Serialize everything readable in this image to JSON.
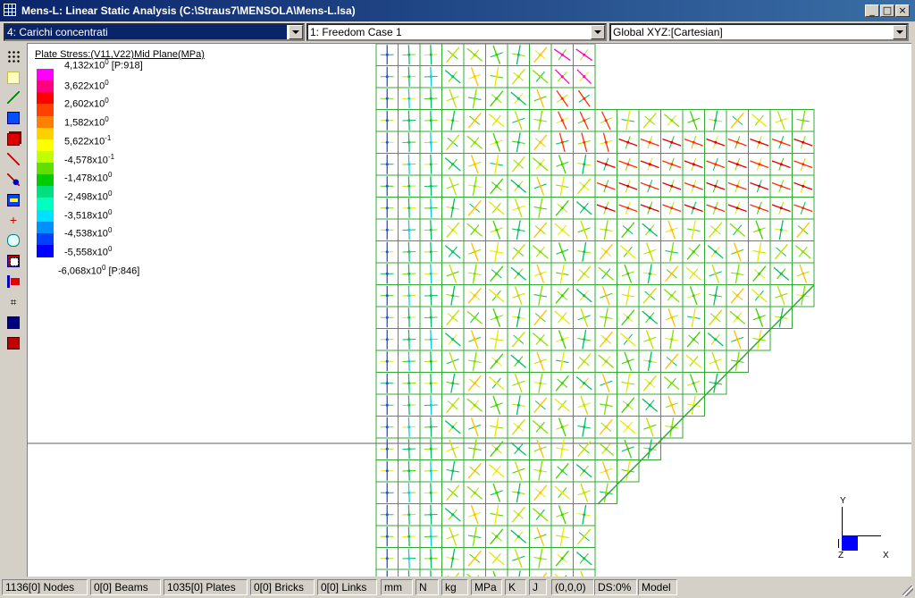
{
  "window": {
    "title": "Mens-L: Linear Static Analysis (C:\\Straus7\\MENSOLA\\Mens-L.lsa)",
    "buttons": [
      "_",
      "□",
      "×"
    ]
  },
  "combos": {
    "load_case": "4: Carichi concentrati",
    "freedom_case": "1: Freedom Case 1",
    "coord_system": "Global XYZ:[Cartesian]"
  },
  "toolbar": [
    "grid-icon",
    "node-icon",
    "beam-icon",
    "plate-icon",
    "brick-icon",
    "link-icon",
    "restraint-icon",
    "force-icon",
    "point-icon",
    "spring-icon",
    "stress-icon",
    "section-icon",
    "dimension-icon",
    "blue-square-icon",
    "red-cube-icon"
  ],
  "legend": {
    "title": "Plate Stress:(V11,V22)Mid Plane(MPa)",
    "entries": [
      {
        "mant": "4,132x10",
        "exp": "0",
        "suffix": " [P:918]"
      },
      {
        "mant": "3,622x10",
        "exp": "0",
        "suffix": ""
      },
      {
        "mant": "2,602x10",
        "exp": "0",
        "suffix": ""
      },
      {
        "mant": "1,582x10",
        "exp": "0",
        "suffix": ""
      },
      {
        "mant": "5,622x10",
        "exp": "-1",
        "suffix": ""
      },
      {
        "mant": "-4,578x10",
        "exp": "-1",
        "suffix": ""
      },
      {
        "mant": "-1,478x10",
        "exp": "0",
        "suffix": ""
      },
      {
        "mant": "-2,498x10",
        "exp": "0",
        "suffix": ""
      },
      {
        "mant": "-3,518x10",
        "exp": "0",
        "suffix": ""
      },
      {
        "mant": "-4,538x10",
        "exp": "0",
        "suffix": ""
      },
      {
        "mant": "-5,558x10",
        "exp": "0",
        "suffix": ""
      },
      {
        "mant": "-6,068x10",
        "exp": "0",
        "suffix": " [P:846]"
      }
    ],
    "colors": [
      "#ff00ff",
      "#ff0080",
      "#ff0000",
      "#ff4000",
      "#ff8000",
      "#ffd000",
      "#ffff00",
      "#c0ff00",
      "#60e000",
      "#00cc00",
      "#00e080",
      "#00ffc0",
      "#00e0ff",
      "#0090ff",
      "#0040ff",
      "#0000ff"
    ]
  },
  "axes": {
    "y": "Y",
    "z": "Z",
    "x": "X"
  },
  "status": {
    "nodes": "1136[0] Nodes",
    "beams": "0[0] Beams",
    "plates": "1035[0] Plates",
    "bricks": "0[0] Bricks",
    "links": "0[0] Links",
    "length_unit": "mm",
    "force_unit": "N",
    "mass_unit": "kg",
    "stress_unit": "MPa",
    "temp_unit": "K",
    "energy_unit": "J",
    "origin": "(0,0,0)",
    "ds": "DS:0%",
    "mode": "Model"
  }
}
